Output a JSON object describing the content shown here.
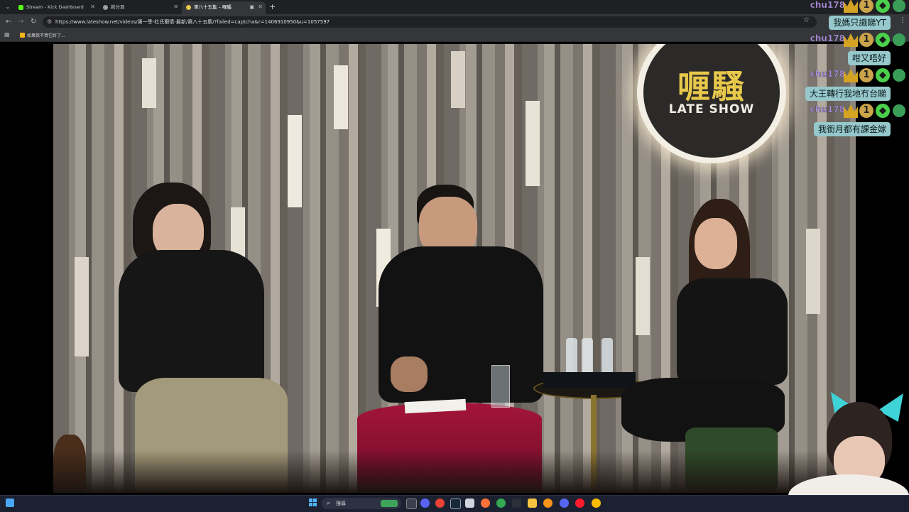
{
  "browser": {
    "tabs": [
      {
        "title": "Stream - Kick Dashboard",
        "favicon_color": "#53fc18",
        "active": false
      },
      {
        "title": "新分頁",
        "favicon_color": "#9aa0a6",
        "active": false
      },
      {
        "title": "第八十五集 – 喱騷",
        "favicon_color": "#e7c84a",
        "active": true
      }
    ],
    "url": "https://www.lateshow.net/videos/第一季-杜氏爾情-最新/第八十五集/?failed=captcha&r=1406910950&u=1057597",
    "bookmark_label": "如果我不買它好了..."
  },
  "video": {
    "sign_chinese": "喱騷",
    "sign_english": "LATE SHOW"
  },
  "chat": {
    "messages": [
      {
        "user": "chu178",
        "text": "我媽只識睇YT"
      },
      {
        "user": "chu178",
        "text": "咁又唔好"
      },
      {
        "user": "chu178",
        "text": "大王轉行我地冇台睇"
      },
      {
        "user": "chu178",
        "text": "我銜月都有課金嫁"
      }
    ],
    "badge_number": "1",
    "colors": {
      "username": "#a98bdb",
      "bubble": "#96c8cc"
    }
  },
  "taskbar": {
    "search_label": "搜尋",
    "icons": [
      "start-icon",
      "search-icon",
      "widgets-icon",
      "task-view-icon",
      "chrome-icon",
      "steam-icon",
      "teams-icon",
      "mail-icon",
      "firefox-icon",
      "chrome-alt-icon",
      "arrow-icon",
      "folder-icon",
      "bitcoin-icon",
      "discord-icon",
      "opera-icon",
      "chrome-canary-icon"
    ]
  }
}
